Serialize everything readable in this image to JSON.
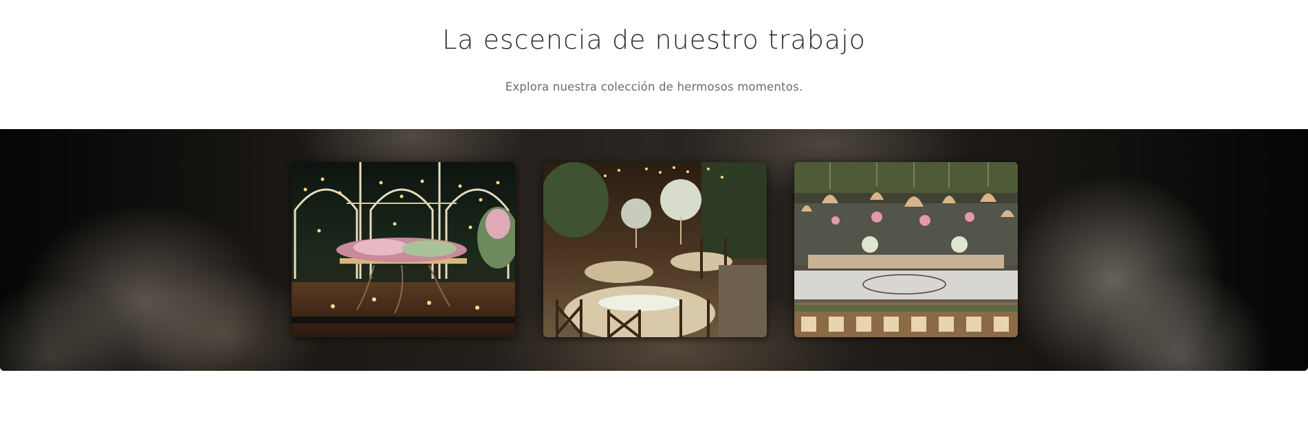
{
  "header": {
    "title": "La escencia de nuestro trabajo",
    "subtitle": "Explora nuestra colección de hermosos momentos."
  },
  "gallery": {
    "images": [
      {
        "name": "event-photo-head-table-arches"
      },
      {
        "name": "event-photo-round-tables"
      },
      {
        "name": "event-photo-hanging-bells-reception"
      }
    ]
  },
  "colors": {
    "title": "#2b2b2b",
    "subtitle": "#6b6b6b",
    "band": "#0b0a09"
  }
}
